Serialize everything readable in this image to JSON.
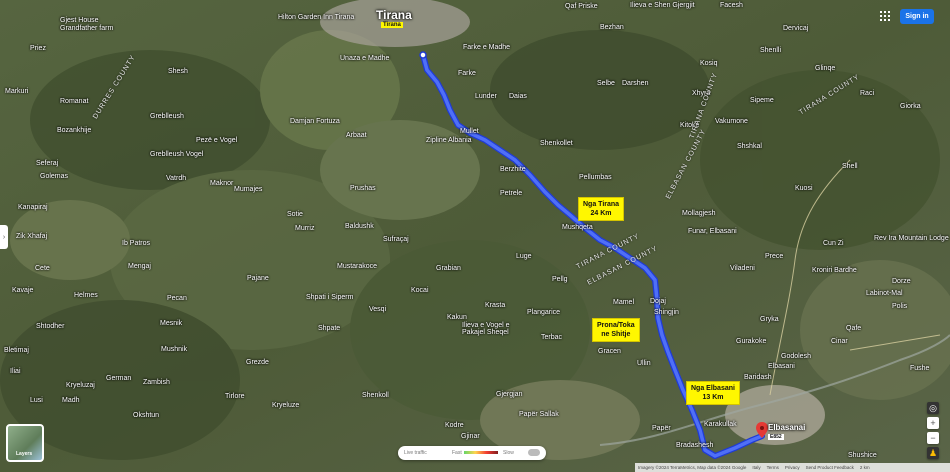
{
  "header": {
    "sign_in_label": "Sign in"
  },
  "places": [
    "Gjest House Grandfather farm",
    "Hilton Garden Inn Tirana",
    "Qaf Priske",
    "Ilieva e Shen Gjergjit",
    "Facesh",
    "Priez",
    "Shesh",
    "Markuri",
    "Romanat",
    "Greblleush",
    "Farke e Madhe",
    "Unaza e Madhe",
    "Farke",
    "Lunder",
    "Daias",
    "Selbe",
    "Darshen",
    "Xhyra",
    "Sipeme",
    "Raci",
    "Giorka",
    "Bozankhije",
    "Pezë e Vogel",
    "Damjan Fortuza",
    "Mullet",
    "Arbaat",
    "Vakumone",
    "Zipline Albania",
    "Shenkollet",
    "Kitoke",
    "Seferaj",
    "Golemas",
    "Kanapiraj",
    "Zik Xhafaj",
    "Cete",
    "Kavaje",
    "Helmes",
    "Shtodher",
    "Bletimaj",
    "Lusi",
    "Kryeluzaj",
    "Madh",
    "Iliai",
    "Greblleush Vogel",
    "Vatrdh",
    "Maknor",
    "Prushas",
    "Mumajes",
    "Berzhite",
    "Petrele",
    "Pellumbas",
    "Mollagjesh",
    "Funar, Elbasani",
    "Sotie",
    "Cun Zi",
    "Shell",
    "Shshkal",
    "Murriz",
    "Ib Patros",
    "Mengaj",
    "Pajane",
    "Baldushk",
    "Sufraçaj",
    "Mustarakoce",
    "Kocai",
    "Shpati i Siperm",
    "Mushqeta",
    "Luge",
    "Pellg",
    "Krasta",
    "Grabian",
    "Plangarice",
    "Dojaj",
    "Mamel",
    "Shingjin",
    "Vesqi",
    "Pecan",
    "Kakun",
    "Ilieva e Vogel e Pakajel Sheqel",
    "Terbac",
    "Shpate",
    "Gracen",
    "Elbasani",
    "Godolesh",
    "Labinot-Mal",
    "Fushe",
    "Polis",
    "Mushnik",
    "Mesnik",
    "German",
    "Zambish",
    "Okshtun",
    "Grezde",
    "Shenkoll",
    "Kryeluze",
    "Kodre",
    "Tirlore",
    "Gjergjan",
    "Gjinar",
    "Bradashesh",
    "Karakullak",
    "Papër Sallak",
    "Papër",
    "Shushice",
    "Rev Ira Mountain Lodge",
    "Kroniri Bardhe",
    "Baridash",
    "Cinar",
    "Gurakoke",
    "Ullin",
    "Dorze",
    "Prece",
    "Viladeni",
    "Kuosi",
    "Gryka",
    "Qafe",
    "Dervicaj",
    "Shenlli",
    "Glinqe",
    "Kosiq",
    "Bezhan",
    "Seminje"
  ],
  "cities": {
    "tirana": "Tirana",
    "elbasani": "Elbasanai"
  },
  "badges": {
    "tirana_badge": "Tirana",
    "e852": "E852"
  },
  "counties": {
    "durres": "DURRES COUNTY",
    "tirana_n": "TIRANA COUNTY",
    "elbasan_n": "ELBASAN COUNTY",
    "tirana_mid": "TIRANA COUNTY",
    "elbasan_mid": "ELBASAN COUNTY",
    "tirana_e": "TIRANA COUNTY"
  },
  "callouts": {
    "nga_tirana": [
      "Nga Tirana",
      "24 Km"
    ],
    "prona": [
      "Prona/Toka",
      "ne Shitje"
    ],
    "nga_elbasani": [
      "Nga Elbasani",
      "13 Km"
    ]
  },
  "traffic_bar": {
    "label": "Live traffic",
    "fast": "Fast",
    "slow": "Slow"
  },
  "layers": {
    "label": "Layers"
  },
  "footer": {
    "imagery": "Imagery ©2024 TerraMetrics, Map data ©2024 Google",
    "country": "Italy",
    "terms": "Terms",
    "privacy": "Privacy",
    "feedback": "Send Product Feedback",
    "scale": "2 km"
  },
  "colors": {
    "route": "#3b5cf5",
    "callout": "#fff700",
    "pin": "#e53935",
    "sign_in": "#1a73e8"
  },
  "icons": {
    "apps": "apps-grid-icon",
    "pin": "map-pin-icon",
    "locate": "my-location-icon",
    "pegman": "pegman-icon"
  }
}
